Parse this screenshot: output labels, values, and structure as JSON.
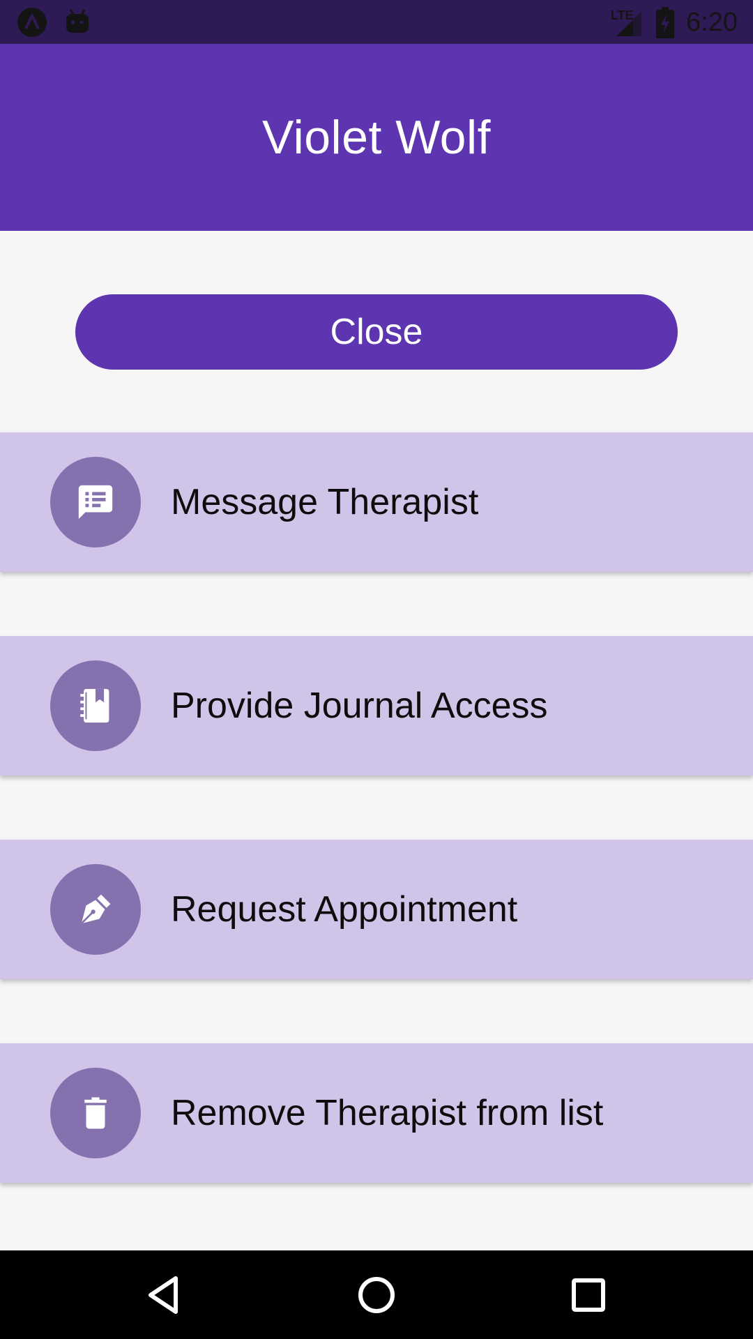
{
  "status_bar": {
    "time": "6:20",
    "network": "LTE",
    "icons": [
      "app-logo-icon",
      "android-icon",
      "signal-icon",
      "battery-charging-icon"
    ]
  },
  "header": {
    "title": "Violet Wolf"
  },
  "close_button": {
    "label": "Close"
  },
  "actions": [
    {
      "label": "Message Therapist",
      "icon": "message-icon"
    },
    {
      "label": "Provide Journal Access",
      "icon": "journal-icon"
    },
    {
      "label": "Request Appointment",
      "icon": "pen-icon"
    },
    {
      "label": "Remove Therapist from list",
      "icon": "trash-icon"
    }
  ],
  "nav_bar": {
    "buttons": [
      "back-icon",
      "home-icon",
      "recents-icon"
    ]
  },
  "colors": {
    "primary": "#5e35b1",
    "status_bar": "#2e1a55",
    "item_background": "#d1c4e9",
    "icon_circle": "#8571ad",
    "page_background": "#f6f6f6"
  }
}
